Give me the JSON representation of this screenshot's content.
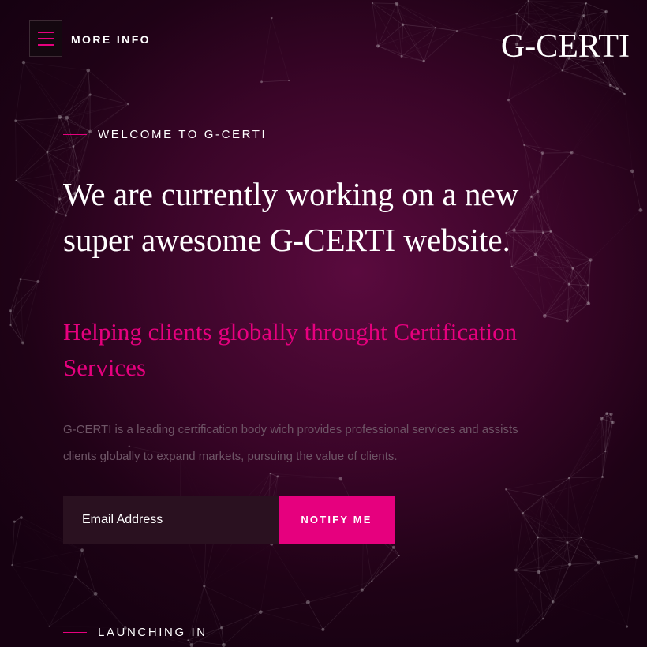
{
  "header": {
    "menu_label": "MORE INFO",
    "logo": "G-CERTI"
  },
  "hero": {
    "welcome": "WELCOME TO G-CERTI",
    "headline_line1": "We are currently working on a new",
    "headline_line2": "super awesome G-CERTI website.",
    "subheadline": "Helping clients globally throught Certification Services",
    "description": "G-CERTI is a leading certification body wich provides professional services and assists clients globally to expand markets, pursuing the value of clients."
  },
  "form": {
    "email_placeholder": "Email Address",
    "email_value": "",
    "notify_label": "NOTIFY ME"
  },
  "footer": {
    "launching": "LAUNCHING IN"
  },
  "colors": {
    "accent": "#e6007e",
    "background": "#3a0528",
    "text": "#ffffff",
    "muted_text": "#6e5566"
  },
  "icons": {
    "menu": "hamburger-menu-icon"
  }
}
